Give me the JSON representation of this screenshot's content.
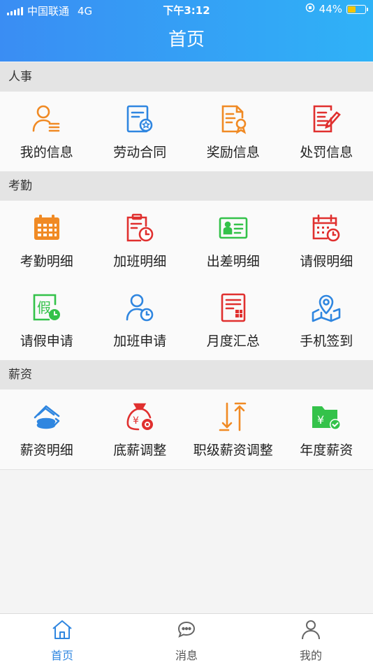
{
  "status_bar": {
    "carrier": "中国联通",
    "network": "4G",
    "time": "下午3:12",
    "battery": "44%"
  },
  "header": {
    "title": "首页"
  },
  "sections": [
    {
      "title": "人事",
      "items": [
        {
          "label": "我的信息",
          "icon": "user-info-icon",
          "color": "#f08a24"
        },
        {
          "label": "劳动合同",
          "icon": "contract-icon",
          "color": "#2f86e0"
        },
        {
          "label": "奖励信息",
          "icon": "reward-certificate-icon",
          "color": "#f08a24"
        },
        {
          "label": "处罚信息",
          "icon": "penalty-document-icon",
          "color": "#e0302f"
        }
      ]
    },
    {
      "title": "考勤",
      "items": [
        {
          "label": "考勤明细",
          "icon": "attendance-calendar-icon",
          "color": "#f08a24"
        },
        {
          "label": "加班明细",
          "icon": "overtime-clipboard-icon",
          "color": "#e0302f"
        },
        {
          "label": "出差明细",
          "icon": "business-trip-card-icon",
          "color": "#34c24a"
        },
        {
          "label": "请假明细",
          "icon": "leave-calendar-clock-icon",
          "color": "#e0302f"
        },
        {
          "label": "请假申请",
          "icon": "leave-apply-icon",
          "color": "#34c24a"
        },
        {
          "label": "加班申请",
          "icon": "overtime-apply-icon",
          "color": "#2f86e0"
        },
        {
          "label": "月度汇总",
          "icon": "monthly-summary-icon",
          "color": "#e0302f"
        },
        {
          "label": "手机签到",
          "icon": "map-checkin-icon",
          "color": "#2f86e0"
        }
      ]
    },
    {
      "title": "薪资",
      "items": [
        {
          "label": "薪资明细",
          "icon": "salary-coins-icon",
          "color": "#2f86e0"
        },
        {
          "label": "底薪调整",
          "icon": "base-salary-bag-icon",
          "color": "#e0302f"
        },
        {
          "label": "职级薪资调整",
          "icon": "rank-arrows-icon",
          "color": "#f08a24"
        },
        {
          "label": "年度薪资",
          "icon": "annual-salary-folder-icon",
          "color": "#34c24a"
        }
      ]
    }
  ],
  "tabbar": {
    "items": [
      {
        "label": "首页",
        "icon": "home-icon",
        "active": true
      },
      {
        "label": "消息",
        "icon": "message-icon",
        "active": false
      },
      {
        "label": "我的",
        "icon": "profile-icon",
        "active": false
      }
    ],
    "active_color": "#2f86e0"
  }
}
